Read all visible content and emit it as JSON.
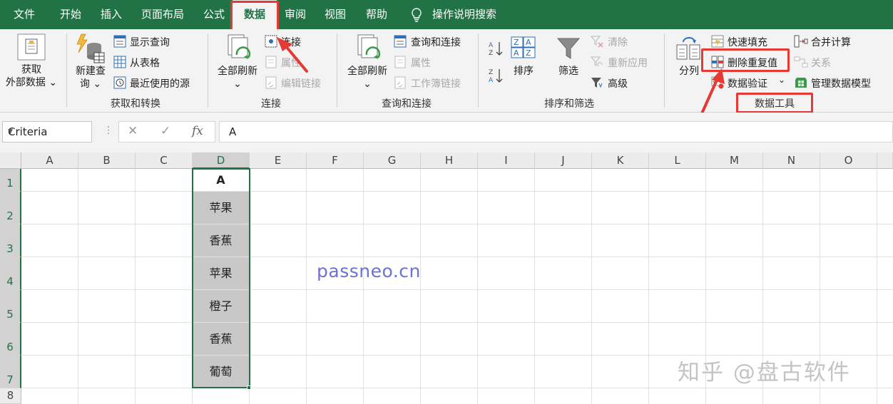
{
  "menu": {
    "tabs": [
      "文件",
      "开始",
      "插入",
      "页面布局",
      "公式",
      "数据",
      "审阅",
      "视图",
      "帮助"
    ],
    "active_tab": "数据",
    "search_label": "操作说明搜索"
  },
  "ribbon": {
    "get_transform": {
      "label": "获取和转换",
      "get_external_line1": "获取",
      "get_external_line2": "外部数据",
      "new_query_line1": "新建查",
      "new_query_line2": "询",
      "show_queries": "显示查询",
      "from_table": "从表格",
      "recent_sources": "最近使用的源"
    },
    "connections": {
      "label": "连接",
      "refresh_all": "全部刷新",
      "connections": "连接",
      "properties": "属性",
      "edit_links": "编辑链接"
    },
    "queries_connections": {
      "label": "查询和连接",
      "refresh_all": "全部刷新",
      "queries_connections": "查询和连接",
      "properties": "属性",
      "workbook_links": "工作簿链接"
    },
    "sort_filter": {
      "label": "排序和筛选",
      "sort": "排序",
      "filter": "筛选",
      "clear": "清除",
      "reapply": "重新应用",
      "advanced": "高级"
    },
    "data_tools": {
      "label": "数据工具",
      "text_to_columns": "分列",
      "flash_fill": "快速填充",
      "remove_duplicates": "删除重复值",
      "data_validation": "数据验证",
      "consolidate": "合并计算",
      "relationships": "关系",
      "manage_data_model": "管理数据模型"
    }
  },
  "formula_bar": {
    "name_box": "Criteria",
    "cancel": "✕",
    "enter": "✓",
    "fx": "fx",
    "value": "A"
  },
  "sheet": {
    "columns": [
      "A",
      "B",
      "C",
      "D",
      "E",
      "F",
      "G",
      "H",
      "I",
      "J",
      "K",
      "L",
      "M",
      "N",
      "O"
    ],
    "rows": [
      "1",
      "2",
      "3",
      "4",
      "5",
      "6",
      "7",
      "8"
    ],
    "selected_column": "D",
    "cells_D": [
      "A",
      "苹果",
      "香蕉",
      "苹果",
      "橙子",
      "香蕉",
      "葡萄"
    ]
  },
  "watermark": "passneo.cn",
  "zhihu_watermark": "知乎 @盘古软件",
  "colors": {
    "excel_green": "#217346",
    "highlight_red": "#e53935",
    "watermark_blue": "#6b72d6"
  }
}
